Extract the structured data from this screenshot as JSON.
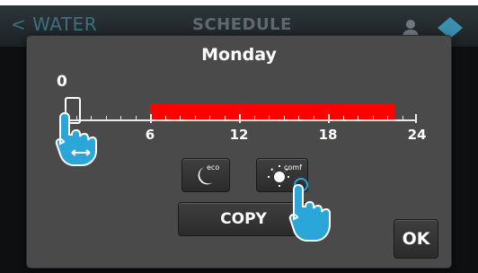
{
  "header": {
    "back_label": "< WATER",
    "title": "SCHEDULE",
    "icons": [
      "user-icon",
      "home-icon"
    ]
  },
  "dialog": {
    "day": "Monday",
    "current_value": "0",
    "timeline": {
      "ticks": [
        "6",
        "12",
        "18",
        "24"
      ],
      "range_hours": [
        0,
        24
      ],
      "comfort_period": [
        6,
        22.5
      ]
    },
    "buttons": {
      "eco_label": "eco",
      "comfort_label": "comf",
      "copy_label": "COPY",
      "ok_label": "OK"
    }
  },
  "colors": {
    "period": "#ff0000",
    "hand": "#2aa6d8",
    "dialog_bg": "#4a4a4a"
  }
}
